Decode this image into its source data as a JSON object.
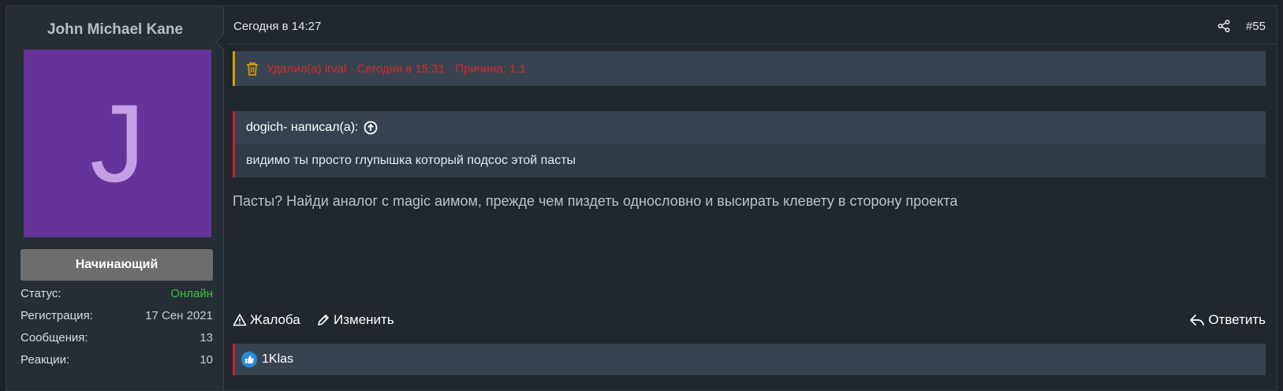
{
  "user": {
    "name": "John Michael Kane",
    "avatar_letter": "J",
    "avatar_color": "#66339a",
    "rank": "Начинающий",
    "stats": [
      {
        "label": "Статус:",
        "value": "Онлайн"
      },
      {
        "label": "Регистрация:",
        "value": "17 Сен 2021"
      },
      {
        "label": "Сообщения:",
        "value": "13"
      },
      {
        "label": "Реакции:",
        "value": "10"
      }
    ]
  },
  "post": {
    "date": "Сегодня в 14:27",
    "number": "#55",
    "deleted_notice": "Удалил(а) irval · Сегодня в 15:31 · Причина: 1.1",
    "quote": {
      "author_line": "dogich- написал(а):",
      "text": "видимо ты просто глупышка который подсос этой пасты"
    },
    "message": "Пасты? Найди аналог с magic аимом, прежде чем пиздеть однословно и высирать клевету в сторону проекта"
  },
  "actions": {
    "report": "Жалоба",
    "edit": "Изменить",
    "reply": "Ответить"
  },
  "reactions": {
    "user": "1Klas",
    "icon": "like-icon"
  },
  "colors": {
    "online": "#37c341",
    "deleted_text": "#d8282d",
    "deleted_border": "#d89b00",
    "quote_border": "#c9202a"
  }
}
